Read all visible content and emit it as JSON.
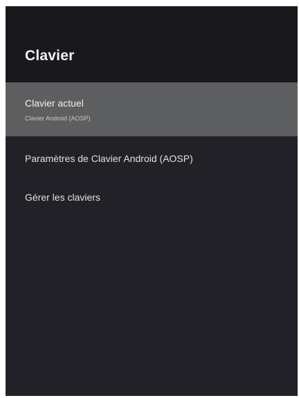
{
  "header": {
    "title": "Clavier"
  },
  "menu": {
    "items": [
      {
        "label": "Clavier actuel",
        "sublabel": "Clavier Android (AOSP)",
        "selected": true
      },
      {
        "label": "Paramètres de Clavier Android (AOSP)"
      },
      {
        "label": "Gérer les claviers"
      }
    ]
  },
  "colors": {
    "background": "#212127",
    "header_background": "#19191d",
    "selected_background": "#5d5e60",
    "text": "#e6e6e6"
  }
}
